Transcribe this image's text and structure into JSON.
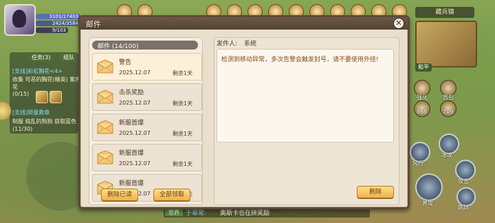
{
  "hud": {
    "hp_text": "3101/17403",
    "mp_text": "2424/3584",
    "xp_text": "9/103"
  },
  "quest": {
    "tab_task": "任务(3)",
    "tab_team": "组队",
    "line1": "[支线]彩虹胸花<4>",
    "line2": "收集 可恶的胸花(精英) 紫色",
    "line3": "花",
    "line4": "(0/15)",
    "line5": "[支线]顽童救章",
    "line6": "制服 捣乱的狗狗 获取蓝色",
    "line7": "(11/30)"
  },
  "server": {
    "label": "藏兵镇",
    "peace": "和平"
  },
  "side": {
    "strengthen": "强化",
    "backpack": "背包",
    "count1": "868",
    "count2": "709",
    "skill_a": "风行",
    "skill_b": "冰攻",
    "skill_c": "攻击",
    "skill_d": "普攻",
    "skill_e": "跳跃"
  },
  "chat": {
    "channel": "世界",
    "name": "于菲常:",
    "message": "奥斯卡也在拼奖励"
  },
  "mail_dialog": {
    "title": "邮件",
    "close": "✕",
    "list_header": "邮件 (14/100)",
    "items": [
      {
        "title": "警告",
        "date": "2025.12.07",
        "remaining": "剩余1天",
        "selected": true
      },
      {
        "title": "击杀奖励",
        "date": "2025.12.07",
        "remaining": "剩余1天",
        "selected": false
      },
      {
        "title": "新服首爆",
        "date": "2025.12.07",
        "remaining": "剩余1天",
        "selected": false
      },
      {
        "title": "新服首爆",
        "date": "2025.12.07",
        "remaining": "剩余1天",
        "selected": false
      },
      {
        "title": "新服首爆",
        "date": "2025.12.07",
        "remaining": "剩余1天",
        "selected": false
      }
    ],
    "delete_read_btn": "删除已读",
    "collect_all_btn": "全部领取",
    "sender_label": "发件人:",
    "sender_value": "系统",
    "content": "检测到移动异常，多次告警会触发封号，请不要使用外挂!",
    "delete_btn": "删除"
  },
  "colors": {
    "dialog_bg": "#e9dfcc",
    "header_bg": "#5e4a38",
    "button_gold": "#f0b248",
    "content_text": "#8a4a1a"
  }
}
